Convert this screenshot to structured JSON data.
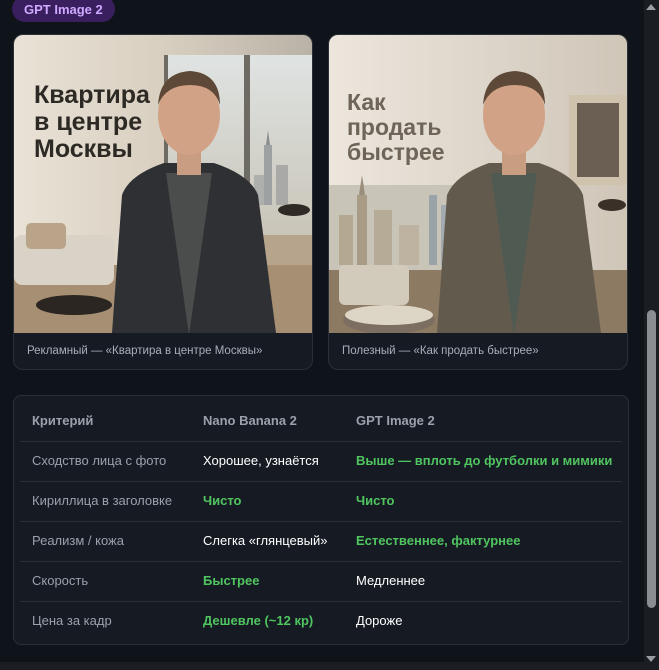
{
  "badge": "GPT Image 2",
  "cards": [
    {
      "headline": [
        "Квартира",
        "в центре",
        "Москвы"
      ],
      "caption": "Рекламный — «Квартира в центре Москвы»"
    },
    {
      "headline": [
        "Как",
        "продать",
        "быстрее"
      ],
      "caption": "Полезный — «Как продать быстрее»"
    }
  ],
  "table": {
    "headers": [
      "Критерий",
      "Nano Banana 2",
      "GPT Image 2"
    ],
    "rows": [
      [
        "Сходство лица с фото",
        "Хорошее, узнаётся",
        "Выше — вплоть до футболки и мимики"
      ],
      [
        "Кириллица в заголовке",
        "Чисто",
        "Чисто"
      ],
      [
        "Реализм / кожа",
        "Слегка «глянцевый»",
        "Естественнее, фактурнее"
      ],
      [
        "Скорость",
        "Быстрее",
        "Медленнее"
      ],
      [
        "Цена за кадр",
        "Дешевле (~12 кр)",
        "Дороже"
      ]
    ]
  },
  "colors": {
    "accent_green": "#4fc45f",
    "badge_bg": "#3a1f5e",
    "badge_text": "#cfa8ff"
  }
}
